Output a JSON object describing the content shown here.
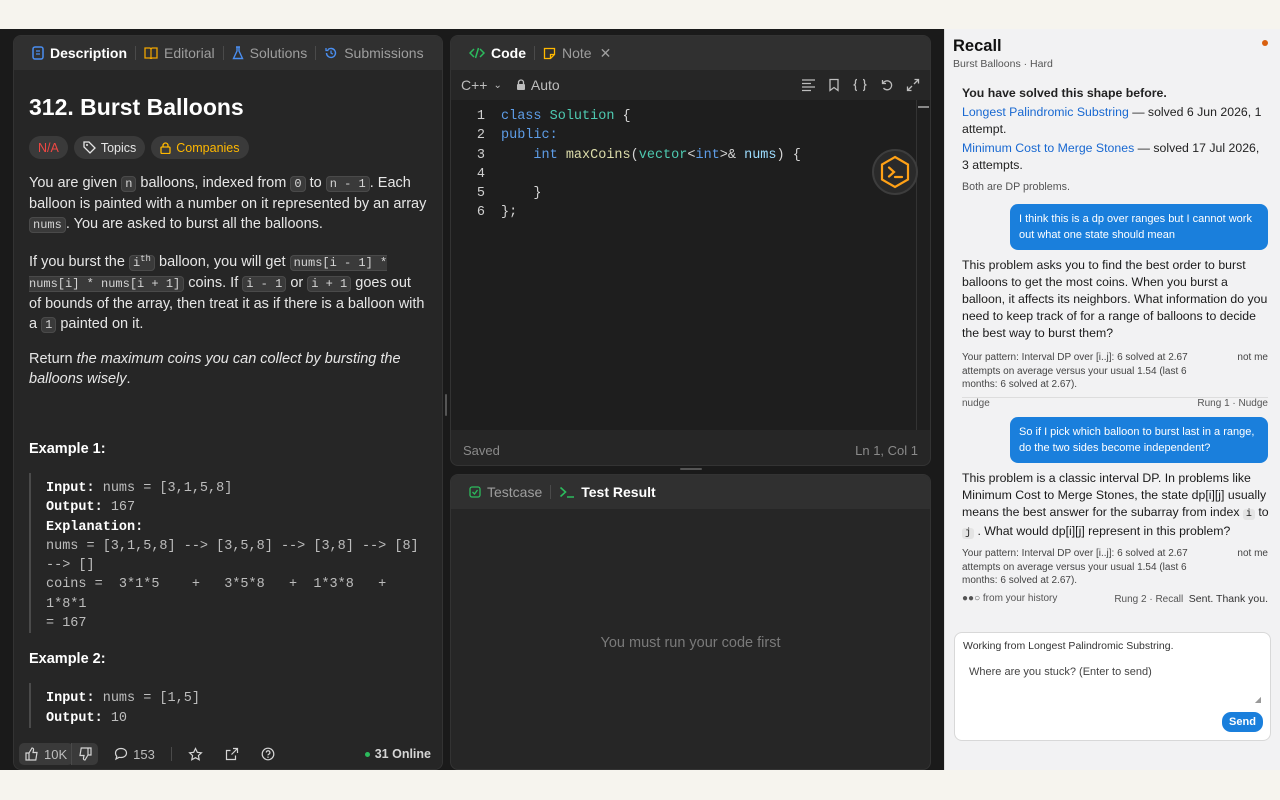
{
  "description_panel": {
    "tabs": [
      {
        "label": "Description"
      },
      {
        "label": "Editorial"
      },
      {
        "label": "Solutions"
      },
      {
        "label": "Submissions"
      }
    ],
    "title": "312. Burst Balloons",
    "chips": {
      "difficulty": "N/A",
      "topics": "Topics",
      "companies": "Companies"
    },
    "p1": {
      "a": "You are given",
      "n": "n",
      "b": "balloons, indexed from",
      "zero": "0",
      "c": "to",
      "nm1": "n - 1",
      "d": ". Each balloon is painted with a number on it represented by an array",
      "nums": "nums",
      "e": ". You are asked to burst all the balloons."
    },
    "p2": {
      "a": "If you burst the",
      "i": "i",
      "sup": "th",
      "b": "balloon, you will get",
      "expr": "nums[i - 1] * nums[i] * nums[i + 1]",
      "c": "coins. If",
      "im1": "i - 1",
      "d": "or",
      "ip1": "i + 1",
      "e": "goes out of bounds of the array, then treat it as if there is a balloon with a",
      "one": "1",
      "f": "painted on it."
    },
    "p3": {
      "a": "Return",
      "em": "the maximum coins you can collect by bursting the balloons wisely",
      "b": "."
    },
    "example1": {
      "title": "Example 1:",
      "input_label": "Input:",
      "input": "nums = [3,1,5,8]",
      "output_label": "Output:",
      "output": "167",
      "explanation_label": "Explanation:",
      "explanation": "nums = [3,1,5,8] --> [3,5,8] --> [3,8] --> [8]\n--> []\ncoins =  3*1*5    +   3*5*8   +  1*3*8   + 1*8*1\n= 167"
    },
    "example2": {
      "title": "Example 2:",
      "input_label": "Input:",
      "input": "nums = [1,5]",
      "output_label": "Output:",
      "output": "10"
    },
    "footer": {
      "likes": "10K",
      "comments": "153",
      "online": "31 Online"
    }
  },
  "code_panel": {
    "tabs": [
      {
        "label": "Code"
      },
      {
        "label": "Note"
      }
    ],
    "language": "C++",
    "mode": "Auto",
    "status_left": "Saved",
    "status_right": "Ln 1, Col 1",
    "lines": [
      {
        "num": "1"
      },
      {
        "num": "2"
      },
      {
        "num": "3"
      },
      {
        "num": "4"
      },
      {
        "num": "5"
      },
      {
        "num": "6"
      }
    ],
    "code": {
      "l1_kw": "class",
      "l1_ty": "Solution",
      "l1_rest": " {",
      "l2_kw": "public:",
      "l3_kw": "int",
      "l3_fn": "maxCoins",
      "l3_a": "(",
      "l3_ty": "vector",
      "l3_b": "<",
      "l3_kw2": "int",
      "l3_c": ">&",
      "l3_vr": "nums",
      "l3_d": ") {",
      "l5": "}",
      "l6": "};"
    }
  },
  "test_panel": {
    "tabs": [
      {
        "label": "Testcase"
      },
      {
        "label": "Test Result"
      }
    ],
    "empty_message": "You must run your code first"
  },
  "recall": {
    "title": "Recall",
    "subtitle": "Burst Balloons · Hard",
    "prior": {
      "heading": "You have solved this shape before.",
      "items": [
        {
          "link": "Longest Palindromic Substring",
          "rest": " — solved 6 Jun 2026, 1 attempt."
        },
        {
          "link": "Minimum Cost to Merge Stones",
          "rest": " — solved 17 Jul 2026, 3 attempts."
        }
      ],
      "note": "Both are DP problems."
    },
    "messages": {
      "user1": "I think this is a dp over ranges but I cannot work out what one state should mean",
      "bot1": "This problem asks you to find the best order to burst balloons to get the most coins. When you burst a balloon, it affects its neighbors. What information do you need to keep track of for a range of balloons to decide the best way to burst them?",
      "pattern1": "Your pattern: Interval DP over [i..j]: 6 solved at 2.67 attempts on average versus your usual 1.54 (last 6 months: 6 solved at 2.67).",
      "notme1": "not me",
      "meta1_left": "nudge",
      "meta1_right": "Rung 1 · Nudge",
      "user2": "So if I pick which balloon to burst last in a range, do the two sides become independent?",
      "bot2_a": "This problem is a classic interval DP. In problems like Minimum Cost to Merge Stones, the state dp[i][j] usually means the best answer for the subarray from index",
      "bot2_i": "i",
      "bot2_b": "to",
      "bot2_j": "j",
      "bot2_c": ". What would dp[i][j] represent in this problem?",
      "pattern2": "Your pattern: Interval DP over [i..j]: 6 solved at 2.67 attempts on average versus your usual 1.54 (last 6 months: 6 solved at 2.67).",
      "notme2": "not me",
      "meta2_dots": "●●○",
      "meta2_left": "from your history",
      "meta2_right": "Rung 2 · Recall",
      "meta2_status": "Sent. Thank you."
    },
    "composer": {
      "hint": "Working from Longest Palindromic Substring.",
      "placeholder": "Where are you stuck? (Enter to send)",
      "send": "Send"
    }
  }
}
